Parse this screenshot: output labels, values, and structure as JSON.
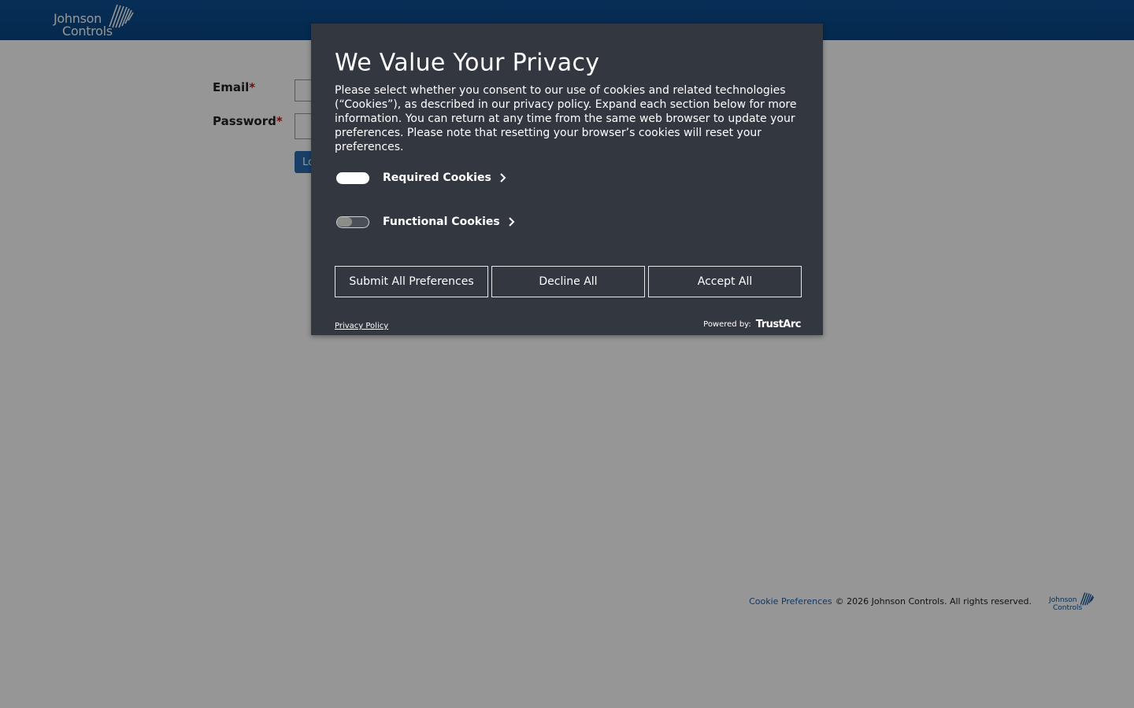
{
  "header": {
    "logo": {
      "line1": "Johnson",
      "line2": "Controls",
      "icon": "johnson-controls-logo-icon"
    }
  },
  "login": {
    "email_label": "Email",
    "password_label": "Password",
    "required_marker": "*",
    "email_value": "",
    "password_value": "",
    "login_button_label": "Lo"
  },
  "footer": {
    "cookie_link": "Cookie Preferences",
    "copyright": "© 2026 Johnson Controls. All rights reserved.",
    "logo": {
      "line1": "Johnson",
      "line2": "Controls"
    }
  },
  "modal": {
    "title": "We Value Your Privacy",
    "description": "Please select whether you consent to our use of cookies and related technologies (“Cookies”), as described in our privacy policy. Expand each section below for more information. You can return at any time from the same web browser to update your preferences. Please note that resetting your browser’s cookies will reset your preferences.",
    "categories": [
      {
        "label": "Required Cookies",
        "enabled": true,
        "icon": "chevron-right-icon"
      },
      {
        "label": "Functional Cookies",
        "enabled": false,
        "icon": "chevron-right-icon"
      }
    ],
    "buttons": {
      "submit": "Submit All Preferences",
      "decline": "Decline All",
      "accept": "Accept All"
    },
    "privacy_policy_link": "Privacy Policy",
    "powered_by_label": "Powered by:",
    "powered_by_brand": "TrustArc"
  },
  "colors": {
    "header_blue": "#0c4f93",
    "modal_bg": "#333740",
    "overlay": "rgba(0,0,0,0.41)",
    "required_marker": "#b31a1a",
    "link_blue": "#1f5fa8"
  }
}
